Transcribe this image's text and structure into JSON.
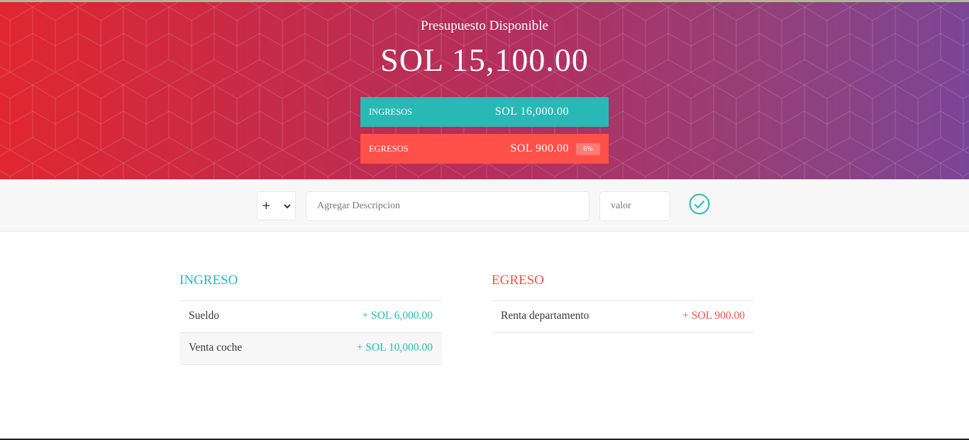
{
  "header": {
    "title": "Presupuesto Disponible",
    "budget": "SOL 15,100.00",
    "income": {
      "label": "Ingresos",
      "value": "SOL 16,000.00"
    },
    "expense": {
      "label": "Egresos",
      "value": "SOL 900.00",
      "percent": "6%"
    }
  },
  "add_form": {
    "type_selected": "+",
    "description_placeholder": "Agregar Descripcion",
    "value_placeholder": "valor",
    "add_icon": "check-circle-icon"
  },
  "income_list": {
    "title": "Ingreso",
    "items": [
      {
        "description": "Sueldo",
        "value": "+ SOL 6,000.00"
      },
      {
        "description": "Venta coche",
        "value": "+ SOL 10,000.00"
      }
    ]
  },
  "expense_list": {
    "title": "Egreso",
    "items": [
      {
        "description": "Renta departamento",
        "value": "+ SOL 900.00"
      }
    ]
  },
  "colors": {
    "income": "#28b9b5",
    "expense": "#ff5049",
    "gradient_start": "#e0272f",
    "gradient_end": "#7b4596"
  }
}
